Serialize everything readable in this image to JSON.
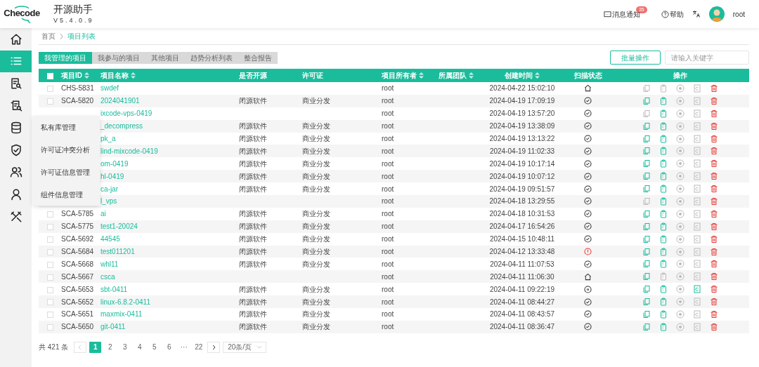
{
  "app": {
    "logo": "Checode",
    "title": "开源助手",
    "version": "V5.4.0.9"
  },
  "header": {
    "notifications": {
      "label": "消息通知",
      "count": "35"
    },
    "help": "帮助",
    "user": "root"
  },
  "sidebar": {
    "items": [
      {
        "selected": false
      },
      {
        "selected": true
      },
      {
        "selected": false
      },
      {
        "selected": false
      },
      {
        "selected": false
      },
      {
        "selected": false
      },
      {
        "selected": false
      },
      {
        "selected": false
      },
      {
        "selected": false
      }
    ]
  },
  "flyout_menu": [
    "私有库管理",
    "许可证冲突分析",
    "许可证信息管理",
    "组件信息管理"
  ],
  "breadcrumb": [
    "首页",
    "项目列表"
  ],
  "tabs": [
    {
      "label": "我管理的项目",
      "selected": true
    },
    {
      "label": "我参与的项目",
      "selected": false
    },
    {
      "label": "其他项目",
      "selected": false
    },
    {
      "label": "趋势分析列表",
      "selected": false
    },
    {
      "label": "整合报告",
      "selected": false
    }
  ],
  "batch_button": "批量操作",
  "search": {
    "placeholder": "请输入关键字"
  },
  "table": {
    "select_all": {
      "checked": false
    },
    "columns": [
      {
        "label": "项目ID",
        "sortable": true
      },
      {
        "label": "项目名称",
        "sortable": true
      },
      {
        "label": "是否开源",
        "sortable": false
      },
      {
        "label": "许可证",
        "sortable": false
      },
      {
        "label": "项目所有者",
        "sortable": true
      },
      {
        "label": "所属团队",
        "sortable": true
      },
      {
        "label": "创建时间",
        "sortable": true
      },
      {
        "label": "扫描状态",
        "sortable": false
      },
      {
        "label": "操作",
        "sortable": false
      }
    ],
    "rows": [
      {
        "id": "CHS-5831",
        "checked": false,
        "name": "swdef",
        "owner": "root",
        "created": "2024-04-22 15:02:10",
        "scan": {
          "kind": "home"
        },
        "copy": false,
        "clip": false,
        "report": false
      },
      {
        "id": "SCA-5820",
        "checked": false,
        "name": "2024041901",
        "open": "闭源软件",
        "license": "商业分发",
        "owner": "root",
        "created": "2024-04-19 17:09:19",
        "scan": {
          "kind": "check"
        },
        "copy": true,
        "clip": true,
        "report": false
      },
      {
        "name": "ixcode-vps-0419",
        "owner": "root",
        "created": "2024-04-19 13:57:20",
        "scan": {
          "kind": "check"
        },
        "copy": false,
        "clip": true,
        "report": false
      },
      {
        "name": "_decompress",
        "open": "闭源软件",
        "license": "商业分发",
        "owner": "root",
        "created": "2024-04-19 13:38:09",
        "scan": {
          "kind": "check"
        },
        "copy": true,
        "clip": true,
        "report": false
      },
      {
        "name": "pk_a",
        "open": "闭源软件",
        "license": "商业分发",
        "owner": "root",
        "created": "2024-04-19 13:13:22",
        "scan": {
          "kind": "check"
        },
        "copy": true,
        "clip": true,
        "report": false
      },
      {
        "name": "lind-mixcode-0419",
        "open": "闭源软件",
        "license": "商业分发",
        "owner": "root",
        "created": "2024-04-19 11:02:33",
        "scan": {
          "kind": "check"
        },
        "copy": true,
        "clip": true,
        "report": false
      },
      {
        "name": "om-0419",
        "open": "闭源软件",
        "license": "商业分发",
        "owner": "root",
        "created": "2024-04-19 10:17:14",
        "scan": {
          "kind": "check"
        },
        "copy": true,
        "clip": true,
        "report": false
      },
      {
        "name": "hl-0419",
        "open": "闭源软件",
        "license": "商业分发",
        "owner": "root",
        "created": "2024-04-19 10:07:12",
        "scan": {
          "kind": "check"
        },
        "copy": true,
        "clip": true,
        "report": false
      },
      {
        "name": "ca-jar",
        "open": "闭源软件",
        "license": "商业分发",
        "owner": "root",
        "created": "2024-04-19 09:51:57",
        "scan": {
          "kind": "check"
        },
        "copy": true,
        "clip": true,
        "report": false
      },
      {
        "name": "l_vps",
        "owner": "root",
        "created": "2024-04-18 13:29:55",
        "scan": {
          "kind": "check"
        },
        "copy": false,
        "clip": true,
        "report": false
      },
      {
        "id": "SCA-5785",
        "checked": false,
        "name": "ai",
        "open": "闭源软件",
        "license": "商业分发",
        "owner": "root",
        "created": "2024-04-18 10:31:53",
        "scan": {
          "kind": "check"
        },
        "copy": true,
        "clip": true,
        "report": false
      },
      {
        "id": "SCA-5775",
        "checked": false,
        "name": "test1-20024",
        "open": "闭源软件",
        "license": "商业分发",
        "owner": "root",
        "created": "2024-04-17 16:54:26",
        "scan": {
          "kind": "check"
        },
        "copy": true,
        "clip": true,
        "report": false
      },
      {
        "id": "SCA-5692",
        "checked": false,
        "name": "44545",
        "open": "闭源软件",
        "license": "商业分发",
        "owner": "root",
        "created": "2024-04-15 10:48:11",
        "scan": {
          "kind": "check"
        },
        "copy": true,
        "clip": true,
        "report": false
      },
      {
        "id": "SCA-5684",
        "checked": false,
        "name": "test011201",
        "open": "闭源软件",
        "license": "商业分发",
        "owner": "root",
        "created": "2024-04-12 13:33:48",
        "scan": {
          "kind": "error"
        },
        "copy": true,
        "clip": true,
        "report": false
      },
      {
        "id": "SCA-5668",
        "checked": false,
        "name": "whl11",
        "open": "闭源软件",
        "license": "商业分发",
        "owner": "root",
        "created": "2024-04-11 11:07:53",
        "scan": {
          "kind": "check"
        },
        "copy": true,
        "clip": true,
        "report": false
      },
      {
        "id": "SCA-5667",
        "checked": false,
        "name": "csca",
        "owner": "root",
        "created": "2024-04-11 11:06:30",
        "scan": {
          "kind": "home"
        },
        "copy": true,
        "clip": false,
        "report": false
      },
      {
        "id": "SCA-5653",
        "checked": false,
        "name": "sbt-0411",
        "open": "闭源软件",
        "license": "商业分发",
        "owner": "root",
        "created": "2024-04-11 09:22:19",
        "scan": {
          "kind": "pause"
        },
        "copy": true,
        "clip": true,
        "report": true
      },
      {
        "id": "SCA-5652",
        "checked": false,
        "name": "linux-6.8.2-0411",
        "open": "闭源软件",
        "license": "商业分发",
        "owner": "root",
        "created": "2024-04-11 08:44:27",
        "scan": {
          "kind": "check"
        },
        "copy": true,
        "clip": true,
        "report": false
      },
      {
        "id": "SCA-5651",
        "checked": false,
        "name": "maxmix-0411",
        "open": "闭源软件",
        "license": "商业分发",
        "owner": "root",
        "created": "2024-04-11 08:43:57",
        "scan": {
          "kind": "check"
        },
        "copy": true,
        "clip": true,
        "report": false
      },
      {
        "id": "SCA-5650",
        "checked": false,
        "name": "git-0411",
        "open": "闭源软件",
        "license": "商业分发",
        "owner": "root",
        "created": "2024-04-11 08:36:47",
        "scan": {
          "kind": "check"
        },
        "copy": true,
        "clip": true,
        "report": false
      }
    ]
  },
  "pagination": {
    "total": "共 421 条",
    "pages": [
      {
        "label": "1",
        "selected": true
      },
      {
        "label": "2",
        "selected": false
      },
      {
        "label": "3",
        "selected": false
      },
      {
        "label": "4",
        "selected": false
      },
      {
        "label": "5",
        "selected": false
      },
      {
        "label": "6",
        "selected": false
      },
      {
        "label": "···",
        "selected": false
      },
      {
        "label": "22",
        "selected": false
      }
    ],
    "page_size": "20条/页"
  }
}
